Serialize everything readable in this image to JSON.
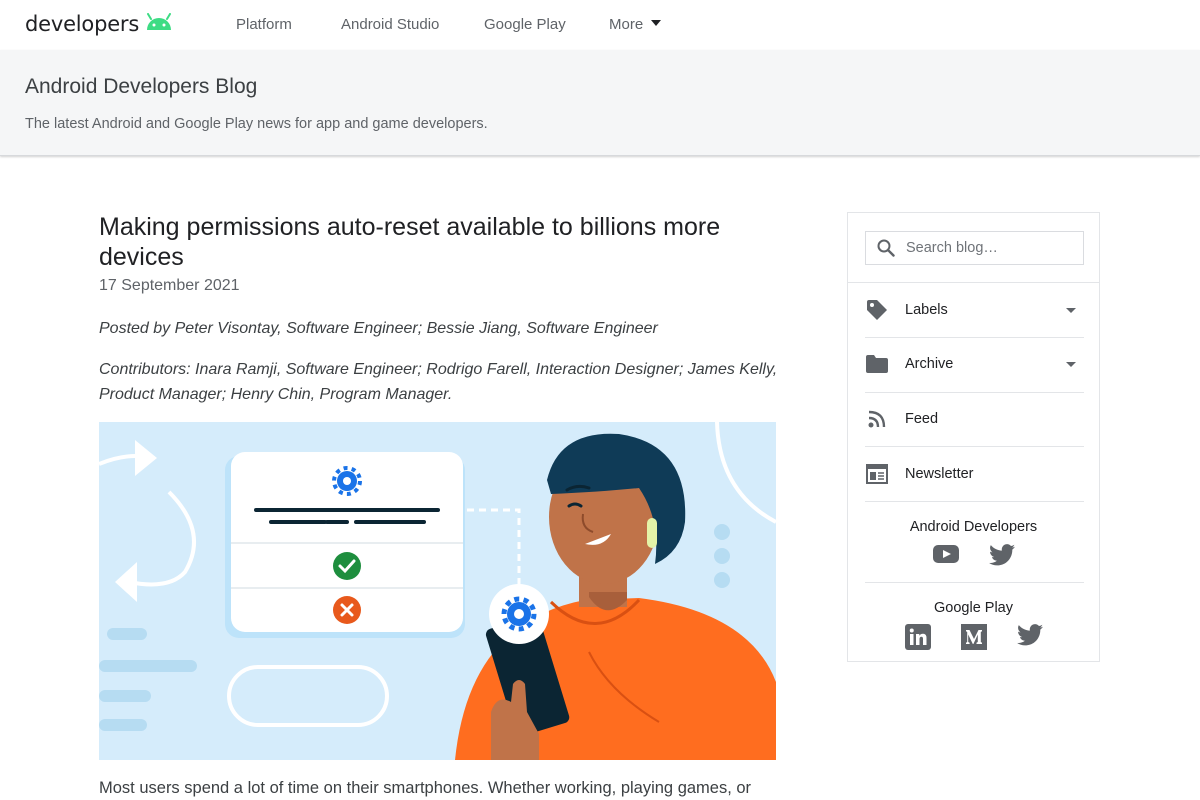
{
  "nav": {
    "logo_text": "developers",
    "items": [
      "Platform",
      "Android Studio",
      "Google Play",
      "More"
    ]
  },
  "blog": {
    "title": "Android Developers Blog",
    "subtitle": "The latest Android and Google Play news for app and game developers."
  },
  "post": {
    "title": "Making permissions auto-reset available to billions more devices",
    "date": "17 September 2021",
    "byline": "Posted by Peter Visontay, Software Engineer; Bessie Jiang, Software Engineer",
    "contributors": "Contributors: Inara Ramji, Software Engineer; Rodrigo Farell, Interaction Designer; James Kelly, Product Manager; Henry Chin, Program Manager.",
    "body_start": "Most users spend a lot of time on their smartphones. Whether working, playing games, or"
  },
  "sidebar": {
    "search_placeholder": "Search blog…",
    "labels": "Labels",
    "archive": "Archive",
    "feed": "Feed",
    "newsletter": "Newsletter",
    "android_developers": "Android Developers",
    "google_play": "Google Play"
  },
  "colors": {
    "android_green": "#3ddc84",
    "hero_background": "#d5ecfb",
    "accent_blue": "#1a73e8",
    "check_green": "#1e8e3e",
    "cross_orange": "#e8591c",
    "shirt_orange": "#ff6d1f"
  },
  "icons": {
    "nav": [
      "android-logo-icon",
      "caret-down-icon"
    ],
    "sidebar": [
      "search-icon",
      "label-tag-icon",
      "folder-icon",
      "rss-feed-icon",
      "newsletter-icon",
      "youtube-icon",
      "twitter-icon",
      "linkedin-icon",
      "medium-icon"
    ]
  }
}
